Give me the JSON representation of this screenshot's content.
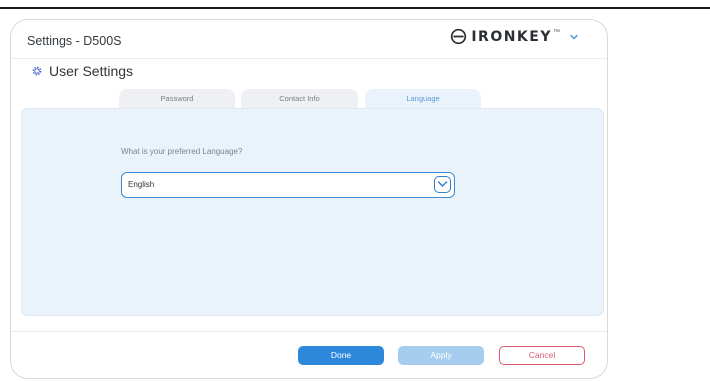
{
  "window": {
    "title": "Settings - D500S",
    "brand": {
      "name": "IRONKEY",
      "tm": "™",
      "logo_icon": "ironkey-logo-icon",
      "dropdown_icon": "chevron-down-icon"
    }
  },
  "section": {
    "icon": "gear-icon",
    "title": "User Settings"
  },
  "tabs": [
    {
      "label": "Password",
      "active": false
    },
    {
      "label": "Contact Info",
      "active": false
    },
    {
      "label": "Language",
      "active": true
    }
  ],
  "language": {
    "question": "What is your preferred Language?",
    "selected": "English",
    "dropdown_icon": "chevron-down-icon"
  },
  "buttons": {
    "done": "Done",
    "apply": "Apply",
    "cancel": "Cancel"
  },
  "colors": {
    "accent": "#2d87da",
    "accent_disabled": "#a6cdee",
    "cancel": "#e0576e",
    "panel": "#eaf3fb"
  }
}
